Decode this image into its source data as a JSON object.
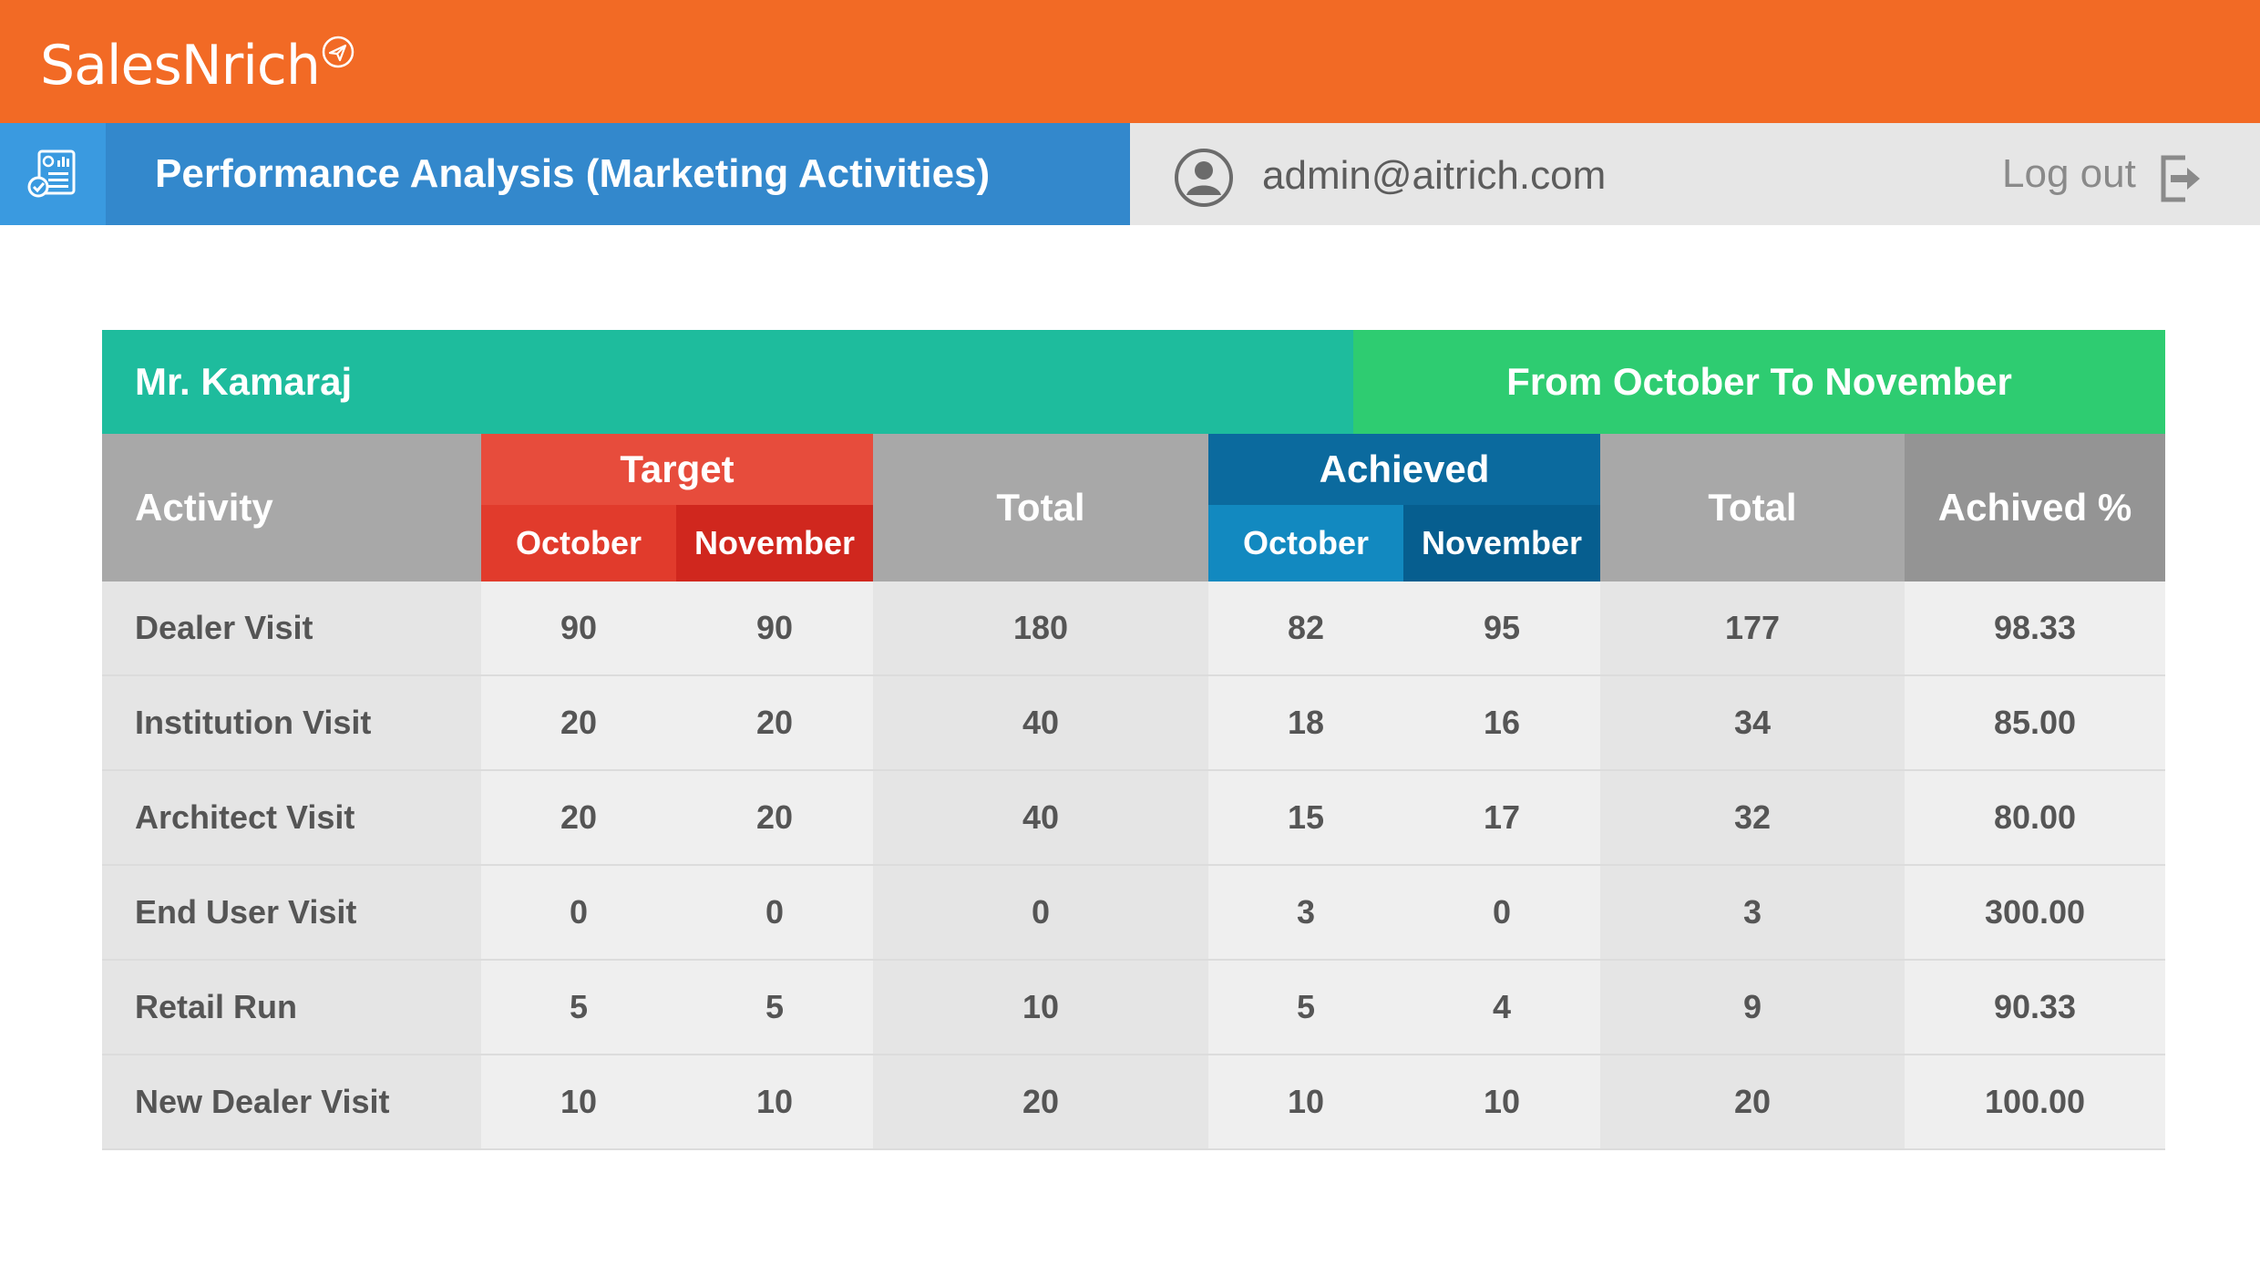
{
  "app": {
    "brand": "SalesNrich"
  },
  "header": {
    "title": "Performance Analysis (Marketing Activities)",
    "user_email": "admin@aitrich.com",
    "logout_label": "Log out",
    "brand_color": "#F26A25",
    "accent_color": "#3388CC"
  },
  "icons": {
    "brand": "paper-plane-icon",
    "page": "report-icon",
    "user": "user-avatar-icon",
    "logout": "logout-icon"
  },
  "report": {
    "employee": "Mr. Kamaraj",
    "period": "From October To November",
    "headers": {
      "activity": "Activity",
      "target": "Target",
      "target_months": [
        "October",
        "November"
      ],
      "target_total": "Total",
      "achieved": "Achieved",
      "achieved_months": [
        "October",
        "November"
      ],
      "achieved_total": "Total",
      "percent": "Achived %"
    },
    "rows": [
      {
        "activity": "Dealer Visit",
        "t_oct": "90",
        "t_nov": "90",
        "t_total": "180",
        "a_oct": "82",
        "a_nov": "95",
        "a_total": "177",
        "pct": "98.33"
      },
      {
        "activity": "Institution Visit",
        "t_oct": "20",
        "t_nov": "20",
        "t_total": "40",
        "a_oct": "18",
        "a_nov": "16",
        "a_total": "34",
        "pct": "85.00"
      },
      {
        "activity": "Architect Visit",
        "t_oct": "20",
        "t_nov": "20",
        "t_total": "40",
        "a_oct": "15",
        "a_nov": "17",
        "a_total": "32",
        "pct": "80.00"
      },
      {
        "activity": "End User Visit",
        "t_oct": "0",
        "t_nov": "0",
        "t_total": "0",
        "a_oct": "3",
        "a_nov": "0",
        "a_total": "3",
        "pct": "300.00"
      },
      {
        "activity": "Retail Run",
        "t_oct": "5",
        "t_nov": "5",
        "t_total": "10",
        "a_oct": "5",
        "a_nov": "4",
        "a_total": "9",
        "pct": "90.33"
      },
      {
        "activity": "New Dealer Visit",
        "t_oct": "10",
        "t_nov": "10",
        "t_total": "20",
        "a_oct": "10",
        "a_nov": "10",
        "a_total": "20",
        "pct": "100.00"
      }
    ]
  }
}
